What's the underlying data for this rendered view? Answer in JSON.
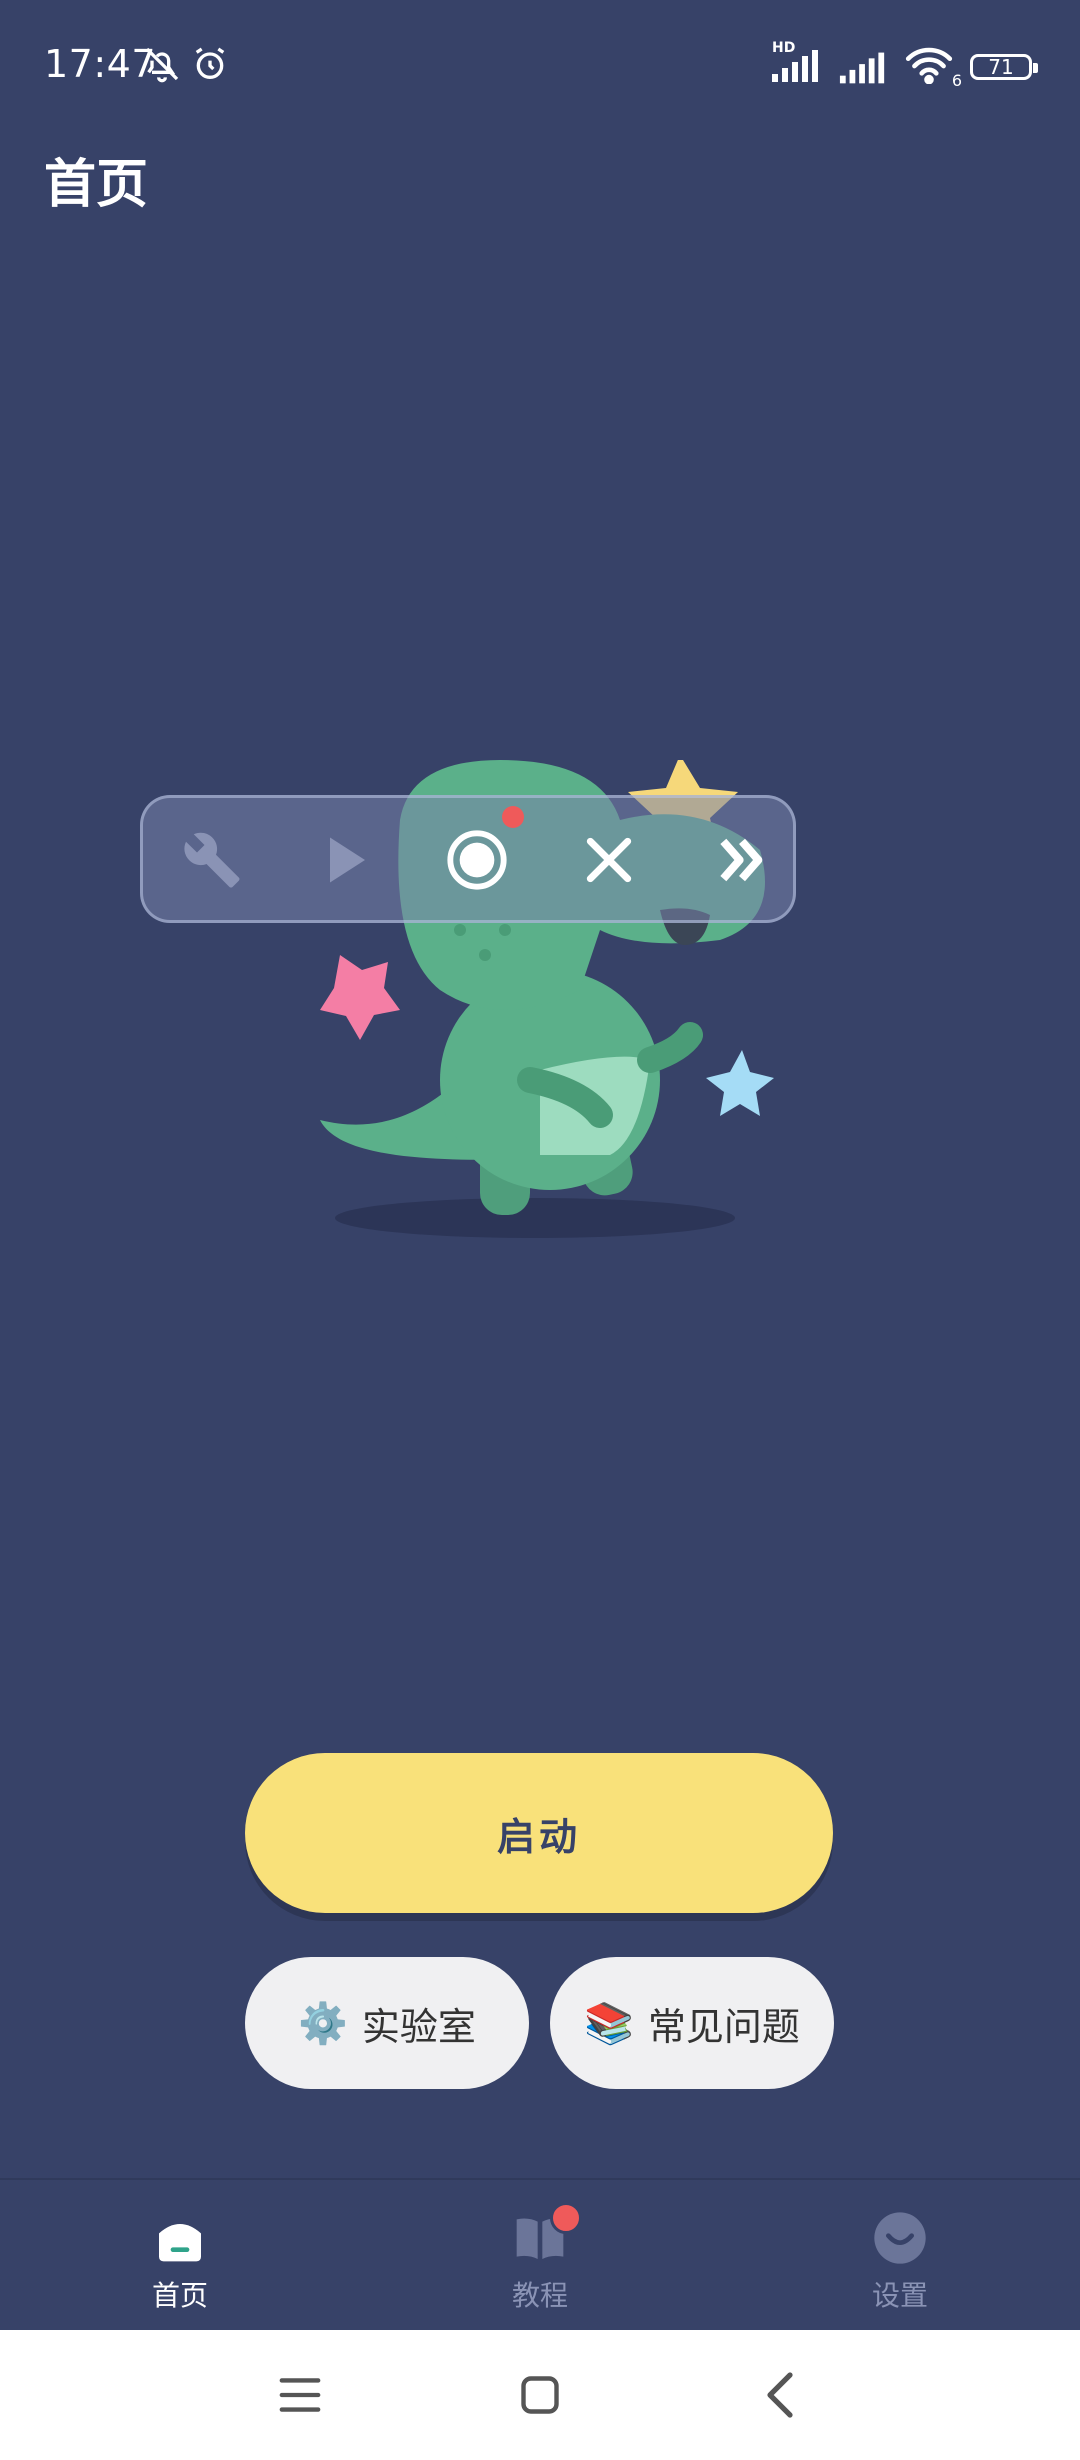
{
  "status_bar": {
    "time": "17:47",
    "network_label": "HD",
    "wifi_label": "6",
    "battery": "71"
  },
  "page": {
    "title": "首页"
  },
  "toolbar": {
    "buttons": [
      "wrench-icon",
      "play-icon",
      "record-icon",
      "close-icon",
      "double-chevron-right-icon"
    ],
    "record_active_color": "#ef5a5a"
  },
  "actions": {
    "start_label": "启动",
    "lab_emoji": "⚙️",
    "lab_label": "实验室",
    "faq_emoji": "📚",
    "faq_label": "常见问题"
  },
  "bottom_nav": {
    "items": [
      {
        "label": "首页",
        "icon": "home-icon",
        "active": true
      },
      {
        "label": "教程",
        "icon": "book-icon",
        "badge": true
      },
      {
        "label": "设置",
        "icon": "smile-icon"
      }
    ]
  },
  "colors": {
    "background": "#374268",
    "accent": "#f9e17a",
    "badge": "#ef5a5a",
    "dino": "#5bb08a"
  }
}
